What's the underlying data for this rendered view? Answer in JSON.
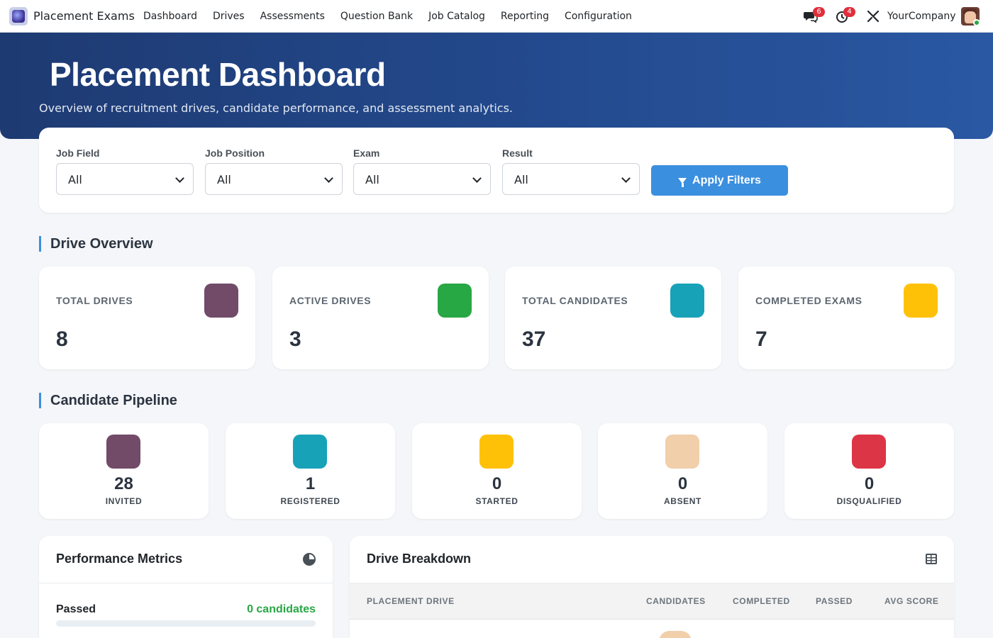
{
  "app": {
    "name": "Placement Exams"
  },
  "menu": [
    "Dashboard",
    "Drives",
    "Assessments",
    "Question Bank",
    "Job Catalog",
    "Reporting",
    "Configuration"
  ],
  "systray": {
    "messages_count": "6",
    "activities_count": "4",
    "company": "YourCompany"
  },
  "hero": {
    "title": "Placement Dashboard",
    "subtitle": "Overview of recruitment drives, candidate performance, and assessment analytics."
  },
  "filters": {
    "fields": [
      {
        "label": "Job Field",
        "value": "All"
      },
      {
        "label": "Job Position",
        "value": "All"
      },
      {
        "label": "Exam",
        "value": "All"
      },
      {
        "label": "Result",
        "value": "All"
      }
    ],
    "apply_label": "Apply Filters"
  },
  "drive_overview": {
    "title": "Drive Overview",
    "cards": [
      {
        "label": "TOTAL DRIVES",
        "value": "8",
        "color": "#714b67"
      },
      {
        "label": "ACTIVE DRIVES",
        "value": "3",
        "color": "#28a745"
      },
      {
        "label": "TOTAL CANDIDATES",
        "value": "37",
        "color": "#17a2b8"
      },
      {
        "label": "COMPLETED EXAMS",
        "value": "7",
        "color": "#ffc107"
      }
    ]
  },
  "pipeline": {
    "title": "Candidate Pipeline",
    "cards": [
      {
        "label": "INVITED",
        "value": "28",
        "color": "#714b67"
      },
      {
        "label": "REGISTERED",
        "value": "1",
        "color": "#17a2b8"
      },
      {
        "label": "STARTED",
        "value": "0",
        "color": "#ffc107"
      },
      {
        "label": "ABSENT",
        "value": "0",
        "color": "#f0cfaa"
      },
      {
        "label": "DISQUALIFIED",
        "value": "0",
        "color": "#dc3545"
      }
    ]
  },
  "performance": {
    "title": "Performance Metrics",
    "metrics": [
      {
        "label": "Passed",
        "value": "0 candidates",
        "fraction": 0
      }
    ]
  },
  "drive_breakdown": {
    "title": "Drive Breakdown",
    "columns": [
      "PLACEMENT DRIVE",
      "CANDIDATES",
      "COMPLETED",
      "PASSED",
      "AVG SCORE"
    ]
  },
  "colors": {
    "accent": "#3b8fdf",
    "hero_start": "#1e3a72",
    "hero_end": "#2a58a3",
    "success": "#28a745"
  }
}
